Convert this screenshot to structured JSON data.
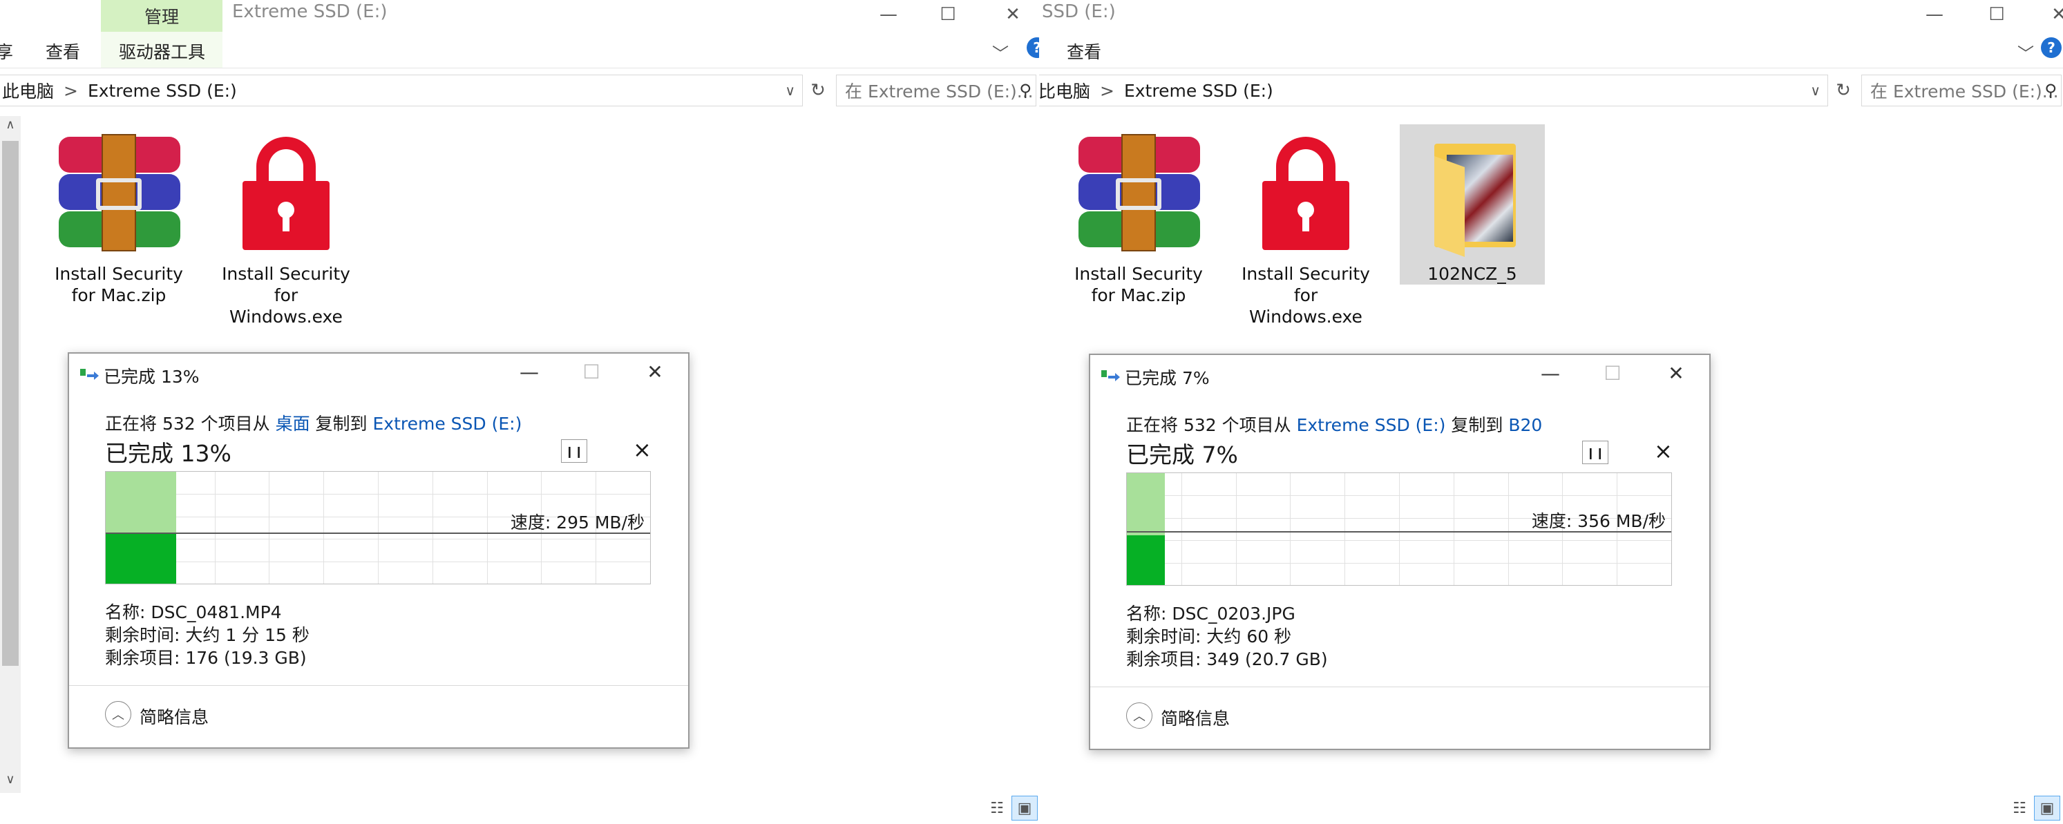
{
  "left": {
    "context_tab": "管理",
    "title": "Extreme SSD (E:)",
    "ribbon_partial": "享",
    "ribbon_view": "查看",
    "ribbon_drive_tools": "驱动器工具",
    "breadcrumb_pc": "此电脑",
    "breadcrumb_sep": ">",
    "breadcrumb_drive": "Extreme SSD (E:)",
    "search_placeholder": "在 Extreme SSD (E:)...",
    "files": [
      {
        "name": "Install Security\nfor Mac.zip",
        "icon": "winrar-archive-icon"
      },
      {
        "name": "Install Security\nfor\nWindows.exe",
        "icon": "lock-icon"
      }
    ],
    "dialog": {
      "title": "已完成 13%",
      "line_prefix": "正在将 532 个项目从 ",
      "source": "桌面",
      "line_mid": " 复制到 ",
      "dest": "Extreme SSD (E:)",
      "big": "已完成 13%",
      "progress_percent": 13,
      "speed": "速度: 295 MB/秒",
      "name_line": "名称:  DSC_0481.MP4",
      "time_line": "剩余时间:  大约 1 分 15 秒",
      "items_line": "剩余项目:  176 (19.3 GB)",
      "fewer_details": "简略信息"
    }
  },
  "right": {
    "title": "SSD (E:)",
    "ribbon_view": "查看",
    "breadcrumb_pc": "比电脑",
    "breadcrumb_sep": ">",
    "breadcrumb_drive": "Extreme SSD (E:)",
    "search_placeholder": "在 Extreme SSD (E:)...",
    "files": [
      {
        "name": "Install Security\nfor Mac.zip",
        "icon": "winrar-archive-icon"
      },
      {
        "name": "Install Security\nfor\nWindows.exe",
        "icon": "lock-icon"
      },
      {
        "name": "102NCZ_5",
        "icon": "folder-with-photos-icon"
      }
    ],
    "dialog": {
      "title": "已完成 7%",
      "line_prefix": "正在将 532 个项目从 ",
      "source": "Extreme SSD (E:)",
      "line_mid": " 复制到 ",
      "dest": "B20",
      "big": "已完成 7%",
      "progress_percent": 7,
      "speed": "速度: 356 MB/秒",
      "name_line": "名称:  DSC_0203.JPG",
      "time_line": "剩余时间:  大约 60 秒",
      "items_line": "剩余项目:  349 (20.7 GB)",
      "fewer_details": "简略信息"
    }
  },
  "colors": {
    "context_tab_bg": "#d5f1c2",
    "progress_light": "#a8e09a",
    "progress_dark": "#06b025",
    "link": "#0a56b4",
    "lock_red": "#e3112a"
  }
}
